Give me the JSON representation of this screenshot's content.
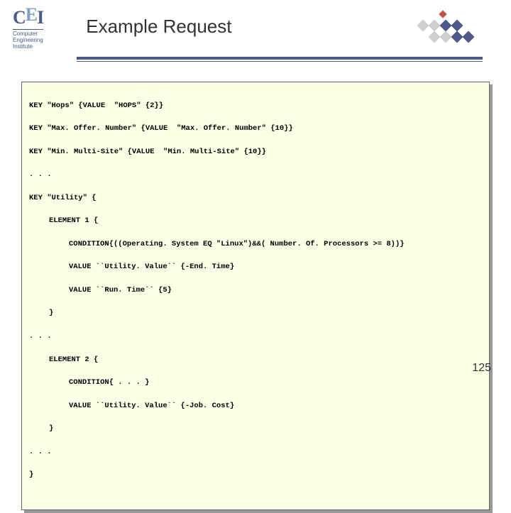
{
  "logo": {
    "c1": "C",
    "e": "E",
    "i": "I",
    "sub_line1": "Computer",
    "sub_line2": "Engineering",
    "sub_line3": "Institute"
  },
  "title": "Example Request",
  "code": {
    "l1": "KEY \"Hops\" {VALUE  \"HOPS\" {2}}",
    "l2": "KEY \"Max. Offer. Number\" {VALUE  \"Max. Offer. Number\" {10}}",
    "l3": "KEY \"Min. Multi-Site\" {VALUE  \"Min. Multi-Site\" {10}}",
    "l4": ". . .",
    "l5": "KEY \"Utility\" {",
    "l6": "ELEMENT 1 {",
    "l7": "CONDITION{((Operating. System EQ \"Linux\")&&( Number. Of. Processors >= 8))}",
    "l8": "VALUE ``Utility. Value`` {-End. Time}",
    "l9": "VALUE ``Run. Time`` {5}",
    "l10": "}",
    "l11": ". . .",
    "l12": "ELEMENT 2 {",
    "l13": "CONDITION{ . . . }",
    "l14": "VALUE ``Utility. Value`` {-Job. Cost}",
    "l15": "}",
    "l16": ". . .",
    "l17": "}"
  },
  "page_number": "125",
  "colors": {
    "dark_blue": "#4b5a86",
    "light_blue": "#7ea3c4",
    "grey": "#cfcfcf",
    "red": "#c0504d",
    "code_bg": "#fdfee6"
  }
}
